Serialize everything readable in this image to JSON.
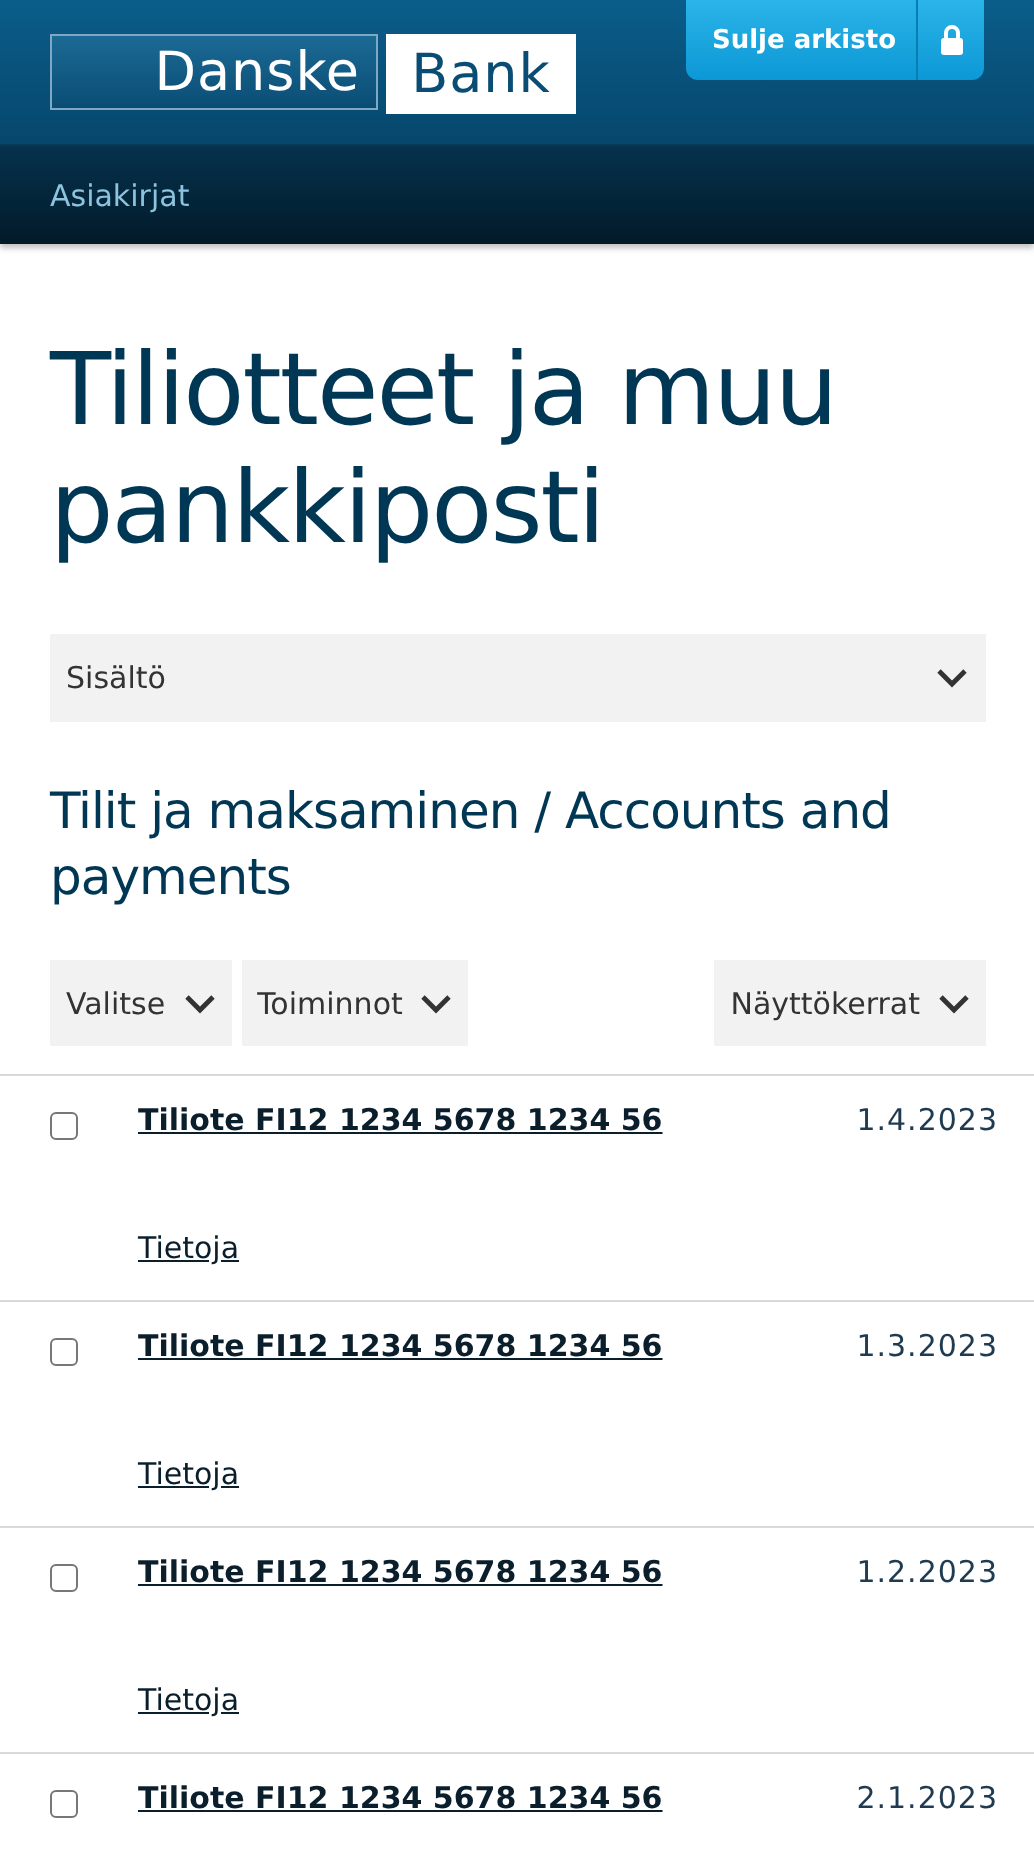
{
  "header": {
    "logo": [
      "Danske",
      "Bank"
    ],
    "close_button": "Sulje arkisto"
  },
  "nav": {
    "label": "Asiakirjat"
  },
  "title": "Tiliotteet ja muu pankkiposti",
  "content_dropdown": "Sisältö",
  "section_title": "Tilit ja maksaminen / Accounts and payments",
  "toolbar": {
    "left": [
      "Valitse",
      "Toiminnot"
    ],
    "right": [
      "Näyttökerrat"
    ]
  },
  "documents": [
    {
      "title": "Tiliote FI12 1234 5678 1234 56",
      "date": "1.4.2023",
      "checked": false,
      "details": "Tietoja"
    },
    {
      "title": "Tiliote FI12 1234 5678 1234 56",
      "date": "1.3.2023",
      "checked": false,
      "details": "Tietoja"
    },
    {
      "title": "Tiliote FI12 1234 5678 1234 56",
      "date": "1.2.2023",
      "checked": false,
      "details": "Tietoja"
    },
    {
      "title": "Tiliote FI12 1234 5678 1234 56",
      "date": "2.1.2023",
      "checked": false
    }
  ]
}
